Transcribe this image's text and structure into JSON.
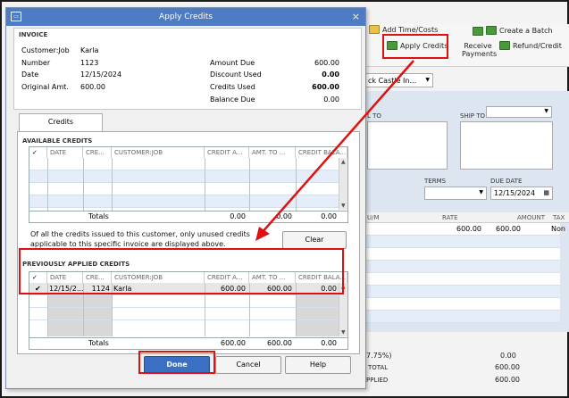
{
  "dialog": {
    "title": "Apply Credits",
    "close": "×",
    "invoice_section": "INVOICE",
    "invoice_fields": [
      {
        "label": "Customer:Job",
        "value": "Karla"
      },
      {
        "label": "Number",
        "value": "1123"
      },
      {
        "label": "Date",
        "value": "12/15/2024"
      },
      {
        "label": "Original Amt.",
        "value": "600.00"
      }
    ],
    "amount_fields": [
      {
        "label": "Amount Due",
        "value": "600.00"
      },
      {
        "label": "Discount Used",
        "value": "0.00"
      },
      {
        "label": "Credits Used",
        "value": "600.00"
      },
      {
        "label": "Balance Due",
        "value": "0.00"
      }
    ],
    "tab": "Credits",
    "available": {
      "title": "AVAILABLE CREDITS",
      "headers": [
        "✓",
        "DATE",
        "CRE...",
        "CUSTOMER:JOB",
        "CREDIT A...",
        "AMT. TO ...",
        "CREDIT BALA..."
      ],
      "totals_label": "Totals",
      "totals": [
        "0.00",
        "0.00",
        "0.00"
      ]
    },
    "note": "Of all the credits issued to this customer, only unused credits applicable to this specific invoice are displayed above.",
    "clear_button": "Clear",
    "previous": {
      "title": "PREVIOUSLY APPLIED CREDITS",
      "headers": [
        "✓",
        "DATE",
        "CRE...",
        "CUSTOMER:JOB",
        "CREDIT A...",
        "AMT. TO ...",
        "CREDIT BALA..."
      ],
      "row": {
        "check": "✔",
        "date": "12/15/2...",
        "credit_no": "1124",
        "customer": "Karla",
        "credit_amt": "600.00",
        "amt_to_use": "600.00",
        "credit_balance": "0.00"
      },
      "totals_label": "Totals",
      "totals": [
        "600.00",
        "600.00",
        "0.00"
      ]
    },
    "buttons": {
      "done": "Done",
      "cancel": "Cancel",
      "help": "Help"
    }
  },
  "background": {
    "ribbon": {
      "add_time_costs": "Add Time/Costs",
      "create_batch": "Create a Batch",
      "apply_credits": "Apply Credits",
      "receive_payments": "Receive Payments",
      "refund_credit": "Refund/Credit",
      "batch_fragment_1": "ch",
      "batch_fragment_2": "e"
    },
    "template_value": "ck Castle In...",
    "bill_to": "L TO",
    "ship_to": "SHIP TO",
    "terms": "TERMS",
    "due_date_label": "DUE DATE",
    "due_date": "12/15/2024",
    "grid_headers": {
      "um": "U/M",
      "rate": "RATE",
      "amount": "AMOUNT",
      "tax": "TAX"
    },
    "line": {
      "rate": "600.00",
      "amount": "600.00",
      "tax": "Non"
    },
    "summary": [
      {
        "label": "7.75%)",
        "value": "0.00"
      },
      {
        "label": "TOTAL",
        "value": "600.00"
      },
      {
        "label": "PPLIED",
        "value": "600.00"
      }
    ]
  },
  "colors": {
    "highlight": "#e01010",
    "titlebar": "#4d7cc4",
    "row_alt": "#e4edf8"
  }
}
